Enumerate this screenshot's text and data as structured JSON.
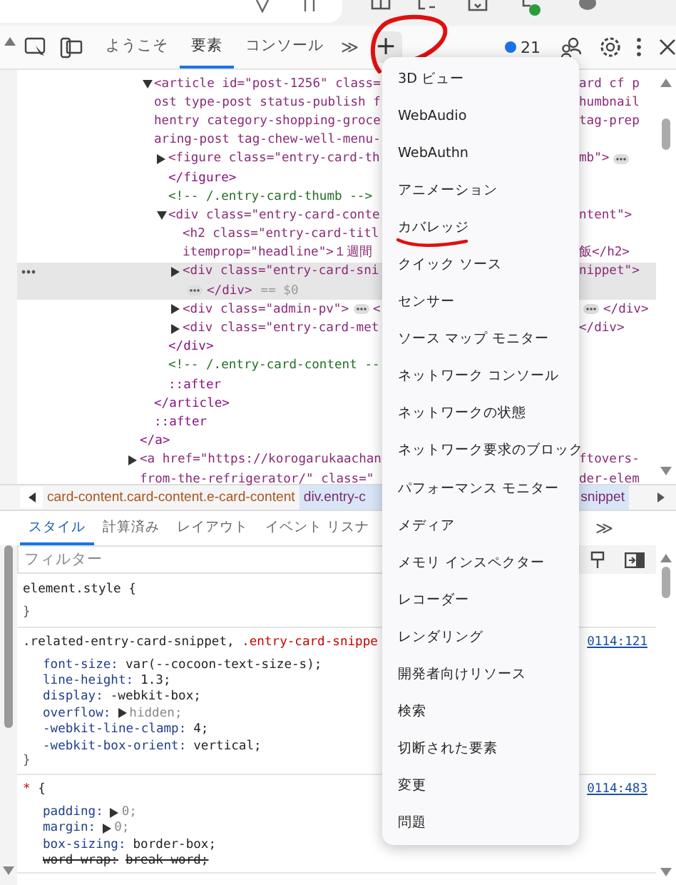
{
  "toolbar": {
    "tabs": [
      {
        "label": "ようこそ",
        "selected": false
      },
      {
        "label": "要素",
        "selected": true
      },
      {
        "label": "コンソール",
        "selected": false
      }
    ],
    "more": "≫",
    "add": "+",
    "add_circled": true,
    "issues": "21"
  },
  "elements": {
    "tree": [
      {
        "kind": "tag",
        "expanded": true,
        "rows": [
          {
            "text": "<article id=\"post-1256\" class=",
            "tail": "ard cf p"
          },
          {
            "text": "ost type-post status-publish f",
            "tail": "humbnail"
          },
          {
            "text": "hentry category-shopping-groce",
            "tail": "tag-prep"
          },
          {
            "text": "aring-post tag-chew-well-menu-"
          }
        ],
        "children": [
          {
            "kind": "tag",
            "expanded": false,
            "rows": [
              {
                "text": "<figure class=\"entry-card-th",
                "tail": "mb\">",
                "tail_ellipsis": true
              }
            ]
          },
          {
            "kind": "close",
            "rows": [
              {
                "text": "</figure>"
              }
            ]
          },
          {
            "kind": "comment",
            "rows": [
              {
                "text": "<!-- /.entry-card-thumb -->"
              }
            ]
          },
          {
            "kind": "tag",
            "expanded": true,
            "rows": [
              {
                "text": "<div class=\"entry-card-conte",
                "tail": "ntent\">"
              }
            ],
            "children": [
              {
                "kind": "tag",
                "rows": [
                  {
                    "text": "<h2 class=\"entry-card-titl"
                  },
                  {
                    "text": "itemprop=\"headline\">１週間",
                    "tail": "飯</h2>"
                  }
                ]
              },
              {
                "kind": "tag",
                "expanded": false,
                "selected": true,
                "rows": [
                  {
                    "text": "<div class=\"entry-card-sni",
                    "tail": "nippet\">"
                  },
                  {
                    "text": "</div>",
                    "ellipsis": true,
                    "note": "== $0"
                  }
                ]
              },
              {
                "kind": "tag",
                "expanded": false,
                "rows": [
                  {
                    "text": "<div class=\"admin-pv\">",
                    "after": "<",
                    "tail": "</div>",
                    "tail_ellipsis": true
                  }
                ]
              },
              {
                "kind": "tag",
                "expanded": false,
                "rows": [
                  {
                    "text": "<div class=\"entry-card-met",
                    "tail": "</div>"
                  }
                ]
              }
            ]
          },
          {
            "kind": "close",
            "rows": [
              {
                "text": "</div>"
              }
            ]
          },
          {
            "kind": "comment",
            "rows": [
              {
                "text": "<!-- /.entry-card-content --"
              }
            ]
          },
          {
            "kind": "pseudo",
            "rows": [
              {
                "text": "::after"
              }
            ]
          }
        ]
      },
      {
        "kind": "close",
        "rows": [
          {
            "text": "</article>"
          }
        ]
      },
      {
        "kind": "pseudo",
        "rows": [
          {
            "text": "::after"
          }
        ]
      }
    ],
    "after": [
      {
        "kind": "close",
        "rows": [
          {
            "text": "</a>"
          }
        ]
      },
      {
        "kind": "tag",
        "expanded": false,
        "rows": [
          {
            "text": "<a href=\"https://korogarukaachan",
            "tail": "ftovers-"
          },
          {
            "text": "from-the-refrigerator/\" class=\"",
            "tail": "der-elem"
          }
        ]
      }
    ]
  },
  "breadcrumbs": [
    {
      "label": "card-content.card-content.e-card-content",
      "selected": false
    },
    {
      "label": "div.entry-c",
      "tail": "snippet",
      "selected": true
    }
  ],
  "styles": {
    "tabs": [
      {
        "label": "スタイル",
        "selected": true
      },
      {
        "label": "計算済み",
        "selected": false
      },
      {
        "label": "レイアウト",
        "selected": false
      },
      {
        "label": "イベント リスナ",
        "selected": false
      }
    ],
    "more": "≫",
    "filter": {
      "placeholder": "フィルター"
    },
    "rules": [
      {
        "selector": [
          {
            "text": "element.style {",
            "matched": false
          }
        ],
        "close": "}"
      },
      {
        "selector": [
          {
            "text": ".related-entry-card-snippet, ",
            "matched": false
          },
          {
            "text": ".entry-card-snippe",
            "matched": true
          }
        ],
        "source": "0114:121",
        "props": [
          {
            "name": "font-size:",
            "value": "var(--cocoon-text-size-s);"
          },
          {
            "name": "line-height:",
            "value": "1.3;"
          },
          {
            "name": "display:",
            "value": "-webkit-box;"
          },
          {
            "name": "overflow:",
            "value": "hidden;",
            "expandable": true
          },
          {
            "name": "-webkit-line-clamp:",
            "value": "4;"
          },
          {
            "name": "-webkit-box-orient:",
            "value": "vertical;"
          }
        ],
        "close": "}"
      },
      {
        "selector": [
          {
            "text": "*",
            "matched": true
          },
          {
            "text": " {",
            "matched": false
          }
        ],
        "source": "0114:483",
        "props": [
          {
            "name": "padding:",
            "value": "0;",
            "expandable": true
          },
          {
            "name": "margin:",
            "value": "0;",
            "expandable": true
          },
          {
            "name": "box-sizing:",
            "value": "border-box;"
          },
          {
            "name": "word-wrap:",
            "value": "break-word;",
            "struck": true
          }
        ]
      }
    ]
  },
  "menu": {
    "items": [
      {
        "label": "3D ビュー",
        "underlined": false
      },
      {
        "label": "WebAudio",
        "underlined": false
      },
      {
        "label": "WebAuthn",
        "underlined": false
      },
      {
        "label": "アニメーション",
        "underlined": false
      },
      {
        "label": "カバレッジ",
        "underlined": true
      },
      {
        "label": "クイック ソース",
        "underlined": false
      },
      {
        "label": "センサー",
        "underlined": false
      },
      {
        "label": "ソース マップ モニター",
        "underlined": false
      },
      {
        "label": "ネットワーク コンソール",
        "underlined": false
      },
      {
        "label": "ネットワークの状態",
        "underlined": false
      },
      {
        "label": "ネットワーク要求のブロック",
        "underlined": false
      },
      {
        "label": "パフォーマンス モニター",
        "underlined": false
      },
      {
        "label": "メディア",
        "underlined": false
      },
      {
        "label": "メモリ インスペクター",
        "underlined": false
      },
      {
        "label": "レコーダー",
        "underlined": false
      },
      {
        "label": "レンダリング",
        "underlined": false
      },
      {
        "label": "開発者向けリソース",
        "underlined": false
      },
      {
        "label": "検索",
        "underlined": false
      },
      {
        "label": "切断された要素",
        "underlined": false
      },
      {
        "label": "変更",
        "underlined": false
      },
      {
        "label": "問題",
        "underlined": false
      }
    ]
  }
}
